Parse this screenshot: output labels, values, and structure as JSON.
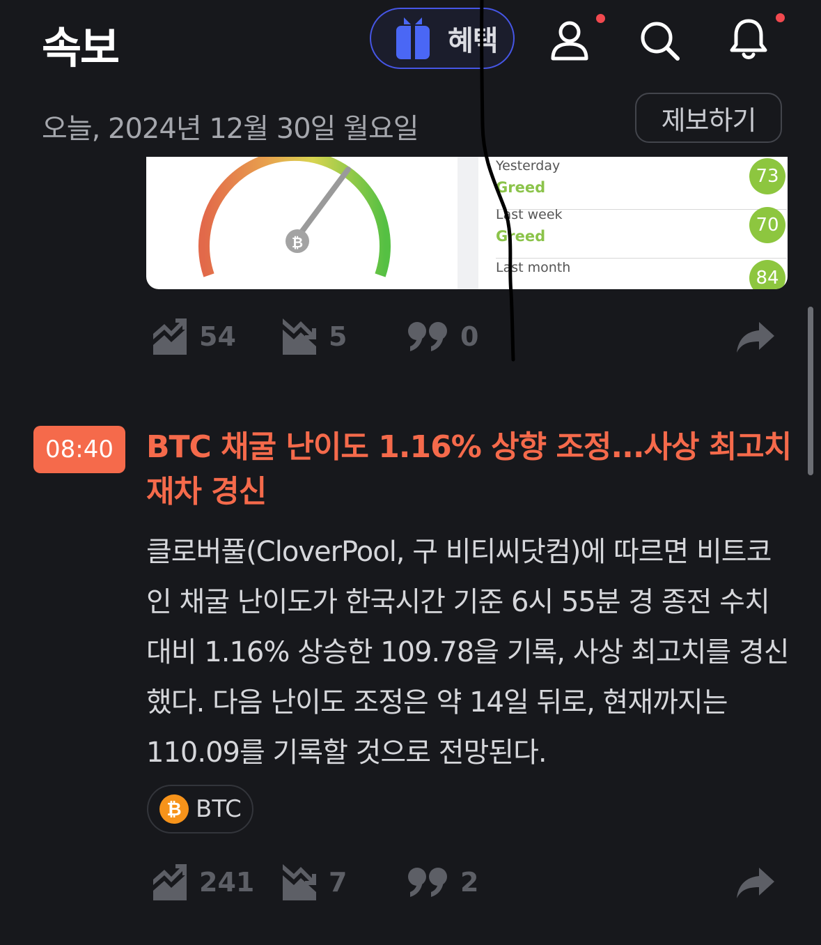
{
  "header": {
    "title": "속보",
    "benefit_label": "혜택",
    "icons": [
      "gift-icon",
      "user-icon",
      "search-icon",
      "bell-icon"
    ],
    "date": "오늘, 2024년 12월 30일 월요일",
    "report_label": "제보하기"
  },
  "previous_item": {
    "image": {
      "rows": [
        {
          "period": "Yesterday",
          "label": "Greed",
          "score": "73"
        },
        {
          "period": "Last week",
          "label": "Greed",
          "score": "70"
        },
        {
          "period": "Last month",
          "label": "",
          "score": "84"
        }
      ]
    },
    "actions": {
      "bullish": "54",
      "bearish": "5",
      "comments": "0"
    }
  },
  "news_item": {
    "time": "08:40",
    "headline": "BTC 채굴 난이도 1.16% 상향 조정...사상 최고치 재차 경신",
    "body": "클로버풀(CloverPool, 구 비티씨닷컴)에 따르면 비트코인 채굴 난이도가 한국시간 기준 6시 55분 경 종전 수치 대비 1.16% 상승한 109.78을 기록, 사상 최고치를 경신했다. 다음 난이도 조정은 약 14일 뒤로, 현재까지는 110.09를 기록할 것으로 전망된다.",
    "tag": "BTC",
    "actions": {
      "bullish": "241",
      "bearish": "7",
      "comments": "2"
    }
  },
  "colors": {
    "background": "#17181c",
    "accent": "#f56a4b",
    "benefit_border": "#4656e6",
    "notification_dot": "#f2494f",
    "greed_green": "#8dc63f",
    "btc_orange": "#f7931a"
  }
}
